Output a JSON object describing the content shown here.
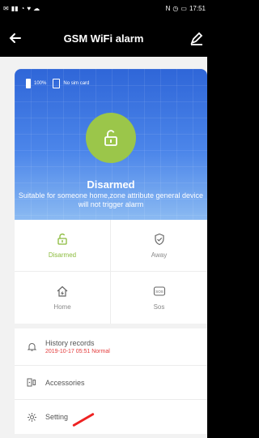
{
  "status_bar": {
    "time": "17:51"
  },
  "topbar": {
    "title": "GSM WiFi alarm",
    "back_icon": "arrow-left-icon",
    "edit_icon": "pencil-icon"
  },
  "device": {
    "battery": "100%",
    "sim_status": "No sim card",
    "state_title": "Disarmed",
    "state_description": "Suitable for someone home,zone attribute general device will not trigger alarm"
  },
  "modes": [
    {
      "label": "Disarmed",
      "icon": "unlock-icon",
      "active": true
    },
    {
      "label": "Away",
      "icon": "shield-check-icon",
      "active": false
    },
    {
      "label": "Home",
      "icon": "home-icon",
      "active": false
    },
    {
      "label": "Sos",
      "icon": "sos-icon",
      "active": false
    }
  ],
  "menu": {
    "history": {
      "label": "History records",
      "sub": "2019-10-17 05:51 Normal",
      "icon": "bell-icon"
    },
    "accessories": {
      "label": "Accessories",
      "icon": "accessories-icon"
    },
    "setting": {
      "label": "Setting",
      "icon": "gear-icon"
    }
  },
  "colors": {
    "accent": "#8bbb3c",
    "card_blue": "#3b74e0",
    "alert_red": "#e33a3a"
  }
}
